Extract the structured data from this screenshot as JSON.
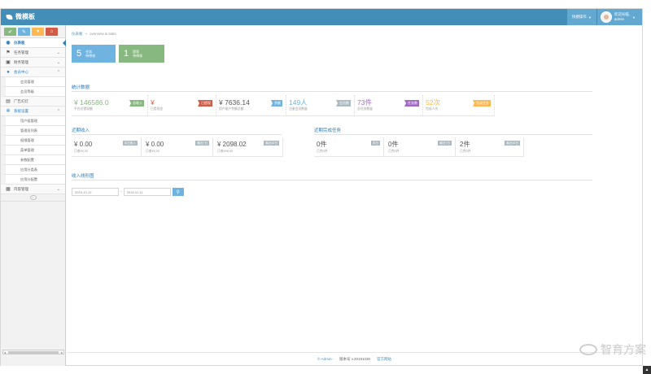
{
  "app": {
    "brand": "微模板"
  },
  "navbar": {
    "quick": "快捷操作",
    "user_name": "欢迎光临,",
    "user_role": "admin"
  },
  "sidebar": {
    "shortcut_icons": [
      "home-icon",
      "pencil-icon",
      "users-icon",
      "cog-icon"
    ],
    "items": [
      {
        "label": "仪表板",
        "icon": "dashboard-icon",
        "active": true
      },
      {
        "label": "任务管理",
        "icon": "flag-icon"
      },
      {
        "label": "财务管理",
        "icon": "money-icon"
      },
      {
        "label": "会员中心",
        "icon": "user-icon",
        "open": true
      },
      {
        "label": "会员管理"
      },
      {
        "label": "会员等级"
      },
      {
        "label": "广告幻灯",
        "icon": "picture-icon"
      },
      {
        "label": "系统设置",
        "icon": "cog-icon",
        "open": true
      },
      {
        "label": "用户组管理"
      },
      {
        "label": "管理员列表"
      },
      {
        "label": "权限管理"
      },
      {
        "label": "菜单管理"
      },
      {
        "label": "参数配置"
      },
      {
        "label": "应用分类表"
      },
      {
        "label": "应用分配置"
      },
      {
        "label": "内容管理",
        "icon": "book-icon"
      }
    ]
  },
  "breadcrumb": {
    "home": "仪表板",
    "sep": "»",
    "current": "overview & stats"
  },
  "stat_boxes": [
    {
      "num": "5",
      "l1": "任务",
      "l2": "待审核"
    },
    {
      "num": "1",
      "l1": "提现",
      "l2": "待审核"
    }
  ],
  "sections": {
    "stats": "统计数据",
    "recent_income": "近期收入",
    "recent_tasks": "近期完成任务",
    "chart": "收入线形图"
  },
  "stats": [
    {
      "big": "¥ 146586.0",
      "small": "平台总提现额",
      "tag": "总收入",
      "tag_color": "#87b87f",
      "color": "#87b87f"
    },
    {
      "big": "¥",
      "small": "已提现金",
      "tag": "已提现",
      "tag_color": "#d15b47",
      "color": "#d15b47"
    },
    {
      "big": "¥ 7636.14",
      "small": "用户账户余额总额",
      "tag": "余额",
      "tag_color": "#6fb3e0",
      "color": "#555555"
    },
    {
      "big": "149人",
      "small": "注册会员数量",
      "tag": "会员数",
      "tag_color": "#abbac3",
      "color": "#6fb3e0"
    },
    {
      "big": "73件",
      "small": "总任务数量",
      "tag": "任务数",
      "tag_color": "#a069c3",
      "color": "#a069c3"
    },
    {
      "big": "52次",
      "small": "完成人次",
      "tag": "完成任务",
      "tag_color": "#ffb752",
      "color": "#ffb752"
    }
  ],
  "income": [
    {
      "big": "¥ 0.00",
      "small": "已收¥0.00",
      "tag": "本日收入"
    },
    {
      "big": "¥ 0.00",
      "small": "已收¥0.00",
      "tag": "最近7日"
    },
    {
      "big": "¥ 2098.02",
      "small": "已收¥98.00",
      "tag": "最近30日"
    }
  ],
  "tasks": [
    {
      "big": "0件",
      "small": "已完0件",
      "tag": "本日"
    },
    {
      "big": "0件",
      "small": "已完0件",
      "tag": "最近7日"
    },
    {
      "big": "2件",
      "small": "已完0件",
      "tag": "最近30日"
    }
  ],
  "daterange": {
    "from": "2019-10-12",
    "sep": "-",
    "to": "2019-11-11"
  },
  "footer": {
    "copy": "©-Admin-",
    "version": "版本号 v.20191030",
    "link": "官方网站"
  },
  "watermark": "智育方案"
}
